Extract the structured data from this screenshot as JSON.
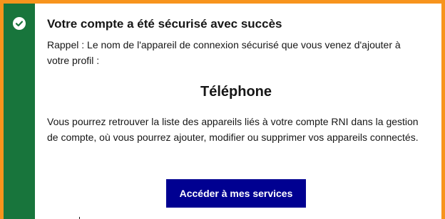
{
  "alert": {
    "status_icon": "check-circle-icon",
    "title": "Votre compte a été sécurisé avec succès",
    "reminder": "Rappel : Le nom de l'appareil de connexion sécurisé que vous venez d'ajouter à votre profil :",
    "device_name": "Téléphone",
    "info": "Vous pourrez retrouver la liste des appareils liés à votre compte RNI dans la gestion de compte, où vous pourrez ajouter, modifier ou supprimer vos appareils connectés.",
    "button_label": "Accéder à mes services"
  },
  "colors": {
    "frame_border": "#f7941d",
    "success_stripe": "#18753c",
    "button_bg": "#000091",
    "text": "#161616"
  }
}
